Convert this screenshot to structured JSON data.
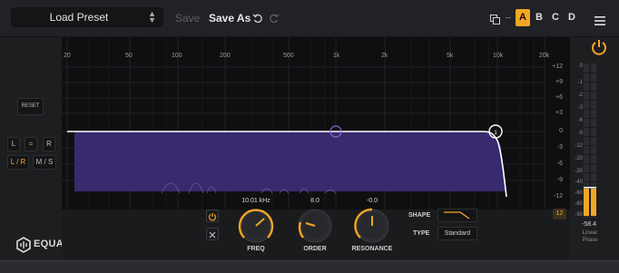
{
  "toolbar": {
    "preset_label": "Load Preset",
    "save_label": "Save",
    "save_as_label": "Save As",
    "slots": [
      "A",
      "B",
      "C",
      "D"
    ],
    "active_slot": "A",
    "accent": "#f5a623"
  },
  "graph": {
    "freq_labels": [
      "20",
      "50",
      "100",
      "200",
      "500",
      "1k",
      "2k",
      "5k",
      "10k",
      "20k"
    ],
    "db_labels": [
      "+12",
      "+9",
      "+6",
      "+3",
      "0",
      "-3",
      "-6",
      "-9",
      "-12"
    ],
    "fill_color": "#3b2c73",
    "curve_color": "#ffffff"
  },
  "left": {
    "reset_label": "RESET",
    "l_label": "L",
    "eq_label": "=",
    "r_label": "R",
    "lr_label": "L / R",
    "ms_label": "M / S",
    "logo_text": "EQUAL"
  },
  "controls": {
    "freq_value": "10.01 kHz",
    "freq_label": "FREQ",
    "order_value": "8.0",
    "order_label": "ORDER",
    "resonance_value": "-0.0",
    "resonance_label": "RESONANCE",
    "shape_label": "SHAPE",
    "type_label": "TYPE",
    "type_value": "Standard"
  },
  "meter": {
    "scale": [
      "0",
      "-1",
      "-2",
      "-3",
      "-6",
      "-9",
      "-12",
      "-20",
      "-30",
      "-40",
      "-60",
      "-80",
      "-90"
    ],
    "value": "-58.4",
    "phase_line1": "Linear",
    "phase_line2": "Phase",
    "range_label": "12"
  }
}
